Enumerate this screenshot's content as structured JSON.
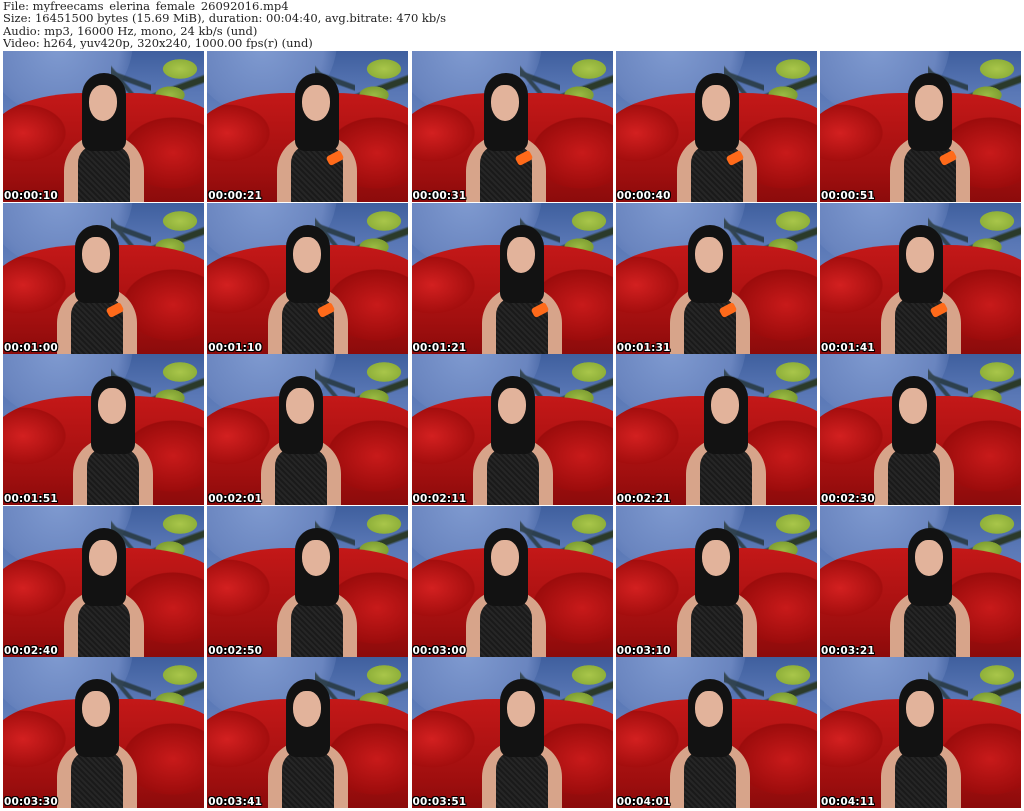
{
  "header": {
    "file_line": "File: myfreecams_elerina_female_26092016.mp4",
    "size_line": "Size: 16451500 bytes (15.69 MiB), duration: 00:04:40, avg.bitrate: 470 kb/s",
    "audio_line": "Audio: mp3, 16000 Hz, mono, 24 kb/s (und)",
    "video_line": "Video: h264, yuv420p, 320x240, 1000.00 fps(r) (und)"
  },
  "thumbnails": [
    {
      "timestamp": "00:00:10",
      "phone": false
    },
    {
      "timestamp": "00:00:21",
      "phone": true
    },
    {
      "timestamp": "00:00:31",
      "phone": true
    },
    {
      "timestamp": "00:00:40",
      "phone": true
    },
    {
      "timestamp": "00:00:51",
      "phone": true
    },
    {
      "timestamp": "00:01:00",
      "phone": true
    },
    {
      "timestamp": "00:01:10",
      "phone": true
    },
    {
      "timestamp": "00:01:21",
      "phone": true
    },
    {
      "timestamp": "00:01:31",
      "phone": true
    },
    {
      "timestamp": "00:01:41",
      "phone": true
    },
    {
      "timestamp": "00:01:51",
      "phone": false
    },
    {
      "timestamp": "00:02:01",
      "phone": false
    },
    {
      "timestamp": "00:02:11",
      "phone": false
    },
    {
      "timestamp": "00:02:21",
      "phone": false
    },
    {
      "timestamp": "00:02:30",
      "phone": false
    },
    {
      "timestamp": "00:02:40",
      "phone": false
    },
    {
      "timestamp": "00:02:50",
      "phone": false
    },
    {
      "timestamp": "00:03:00",
      "phone": false
    },
    {
      "timestamp": "00:03:10",
      "phone": false
    },
    {
      "timestamp": "00:03:21",
      "phone": false
    },
    {
      "timestamp": "00:03:30",
      "phone": false
    },
    {
      "timestamp": "00:03:41",
      "phone": false
    },
    {
      "timestamp": "00:03:51",
      "phone": false
    },
    {
      "timestamp": "00:04:01",
      "phone": false
    },
    {
      "timestamp": "00:04:11",
      "phone": false
    }
  ],
  "colors": {
    "wall_blue": "#5a78b6",
    "couch_red": "#b51414",
    "palm_green": "#9bbb43",
    "phone_orange": "#ff6a1a",
    "stamp_text": "#ffffff"
  }
}
